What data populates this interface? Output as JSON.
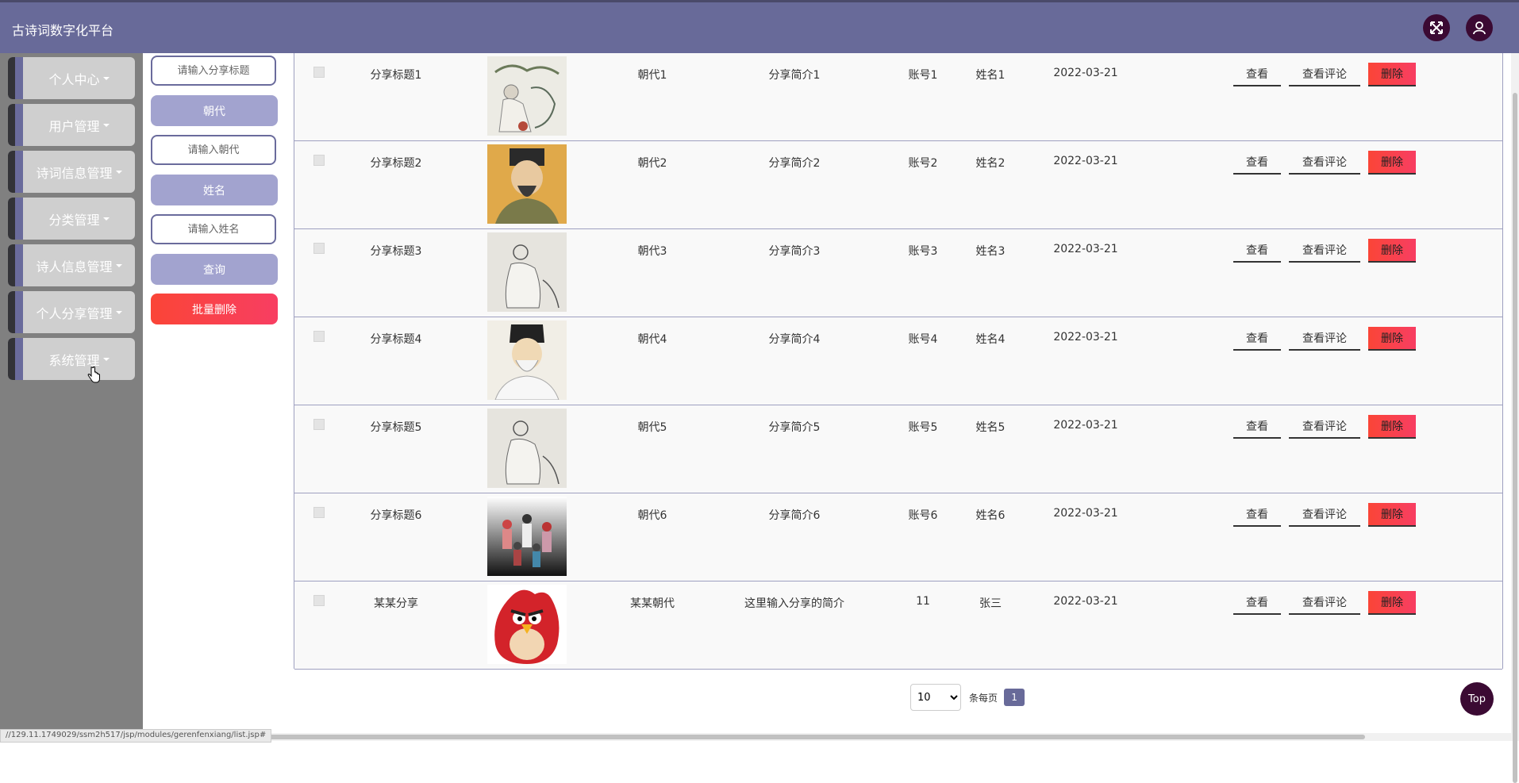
{
  "app": {
    "title": "古诗词数字化平台"
  },
  "header": {
    "icons": [
      "fullscreen-icon",
      "user-icon"
    ]
  },
  "sidebar": {
    "items": [
      {
        "label": "个人中心"
      },
      {
        "label": "用户管理"
      },
      {
        "label": "诗词信息管理"
      },
      {
        "label": "分类管理"
      },
      {
        "label": "诗人信息管理"
      },
      {
        "label": "个人分享管理"
      },
      {
        "label": "系统管理"
      }
    ]
  },
  "filter": {
    "title_placeholder": "请输入分享标题",
    "dynasty_label": "朝代",
    "dynasty_placeholder": "请输入朝代",
    "name_label": "姓名",
    "name_placeholder": "请输入姓名",
    "search_label": "查询",
    "batch_delete_label": "批量删除"
  },
  "table": {
    "actions": {
      "view": "查看",
      "comments": "查看评论",
      "delete": "删除"
    },
    "rows": [
      {
        "title": "分享标题1",
        "dynasty": "朝代1",
        "intro": "分享简介1",
        "account": "账号1",
        "name": "姓名1",
        "date": "2022-03-21",
        "image": "painting-old-man"
      },
      {
        "title": "分享标题2",
        "dynasty": "朝代2",
        "intro": "分享简介2",
        "account": "账号2",
        "name": "姓名2",
        "date": "2022-03-21",
        "image": "portrait-scholar-yellow"
      },
      {
        "title": "分享标题3",
        "dynasty": "朝代3",
        "intro": "分享简介3",
        "account": "账号3",
        "name": "姓名3",
        "date": "2022-03-21",
        "image": "sketch-poet"
      },
      {
        "title": "分享标题4",
        "dynasty": "朝代4",
        "intro": "分享简介4",
        "account": "账号4",
        "name": "姓名4",
        "date": "2022-03-21",
        "image": "portrait-poet-white"
      },
      {
        "title": "分享标题5",
        "dynasty": "朝代5",
        "intro": "分享简介5",
        "account": "账号5",
        "name": "姓名5",
        "date": "2022-03-21",
        "image": "sketch-poet"
      },
      {
        "title": "分享标题6",
        "dynasty": "朝代6",
        "intro": "分享简介6",
        "account": "账号6",
        "name": "姓名6",
        "date": "2022-03-21",
        "image": "ancient-figures-group"
      },
      {
        "title": "某某分享",
        "dynasty": "某某朝代",
        "intro": "这里输入分享的简介",
        "account": "11",
        "name": "张三",
        "date": "2022-03-21",
        "image": "red-bird-cartoon"
      }
    ]
  },
  "pagination": {
    "page_size": "10",
    "page_size_options": [
      "10"
    ],
    "per_page_label": "条每页",
    "current_page": "1"
  },
  "back_to_top_label": "Top",
  "status_url": "//129.11.1749029/ssm2h517/jsp/modules/gerenfenxiang/list.jsp#",
  "colors": {
    "header": "#686a99",
    "accent": "#a2a3cf",
    "danger": "#fa4537",
    "dark": "#3b0a33"
  }
}
